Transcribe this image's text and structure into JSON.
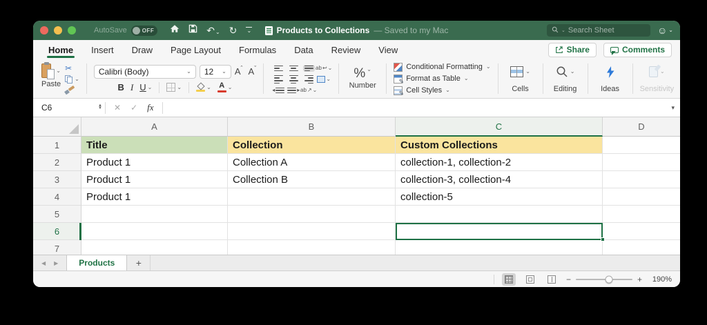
{
  "colors": {
    "accent": "#217346",
    "titlebar_green": "#3a6b4f",
    "selection_green": "#1e7145",
    "fill_green": "#cbdfb8",
    "fill_yellow": "#fae49e"
  },
  "titlebar": {
    "autosave_label": "AutoSave",
    "autosave_state": "OFF",
    "doc_title": "Products to Collections",
    "doc_status": "— Saved to my Mac",
    "search_placeholder": "Search Sheet"
  },
  "ribbon": {
    "tabs": [
      {
        "label": "Home"
      },
      {
        "label": "Insert"
      },
      {
        "label": "Draw"
      },
      {
        "label": "Page Layout"
      },
      {
        "label": "Formulas"
      },
      {
        "label": "Data"
      },
      {
        "label": "Review"
      },
      {
        "label": "View"
      }
    ],
    "active_tab": "Home",
    "share_label": "Share",
    "comments_label": "Comments"
  },
  "toolbar": {
    "paste_label": "Paste",
    "font_name": "Calibri (Body)",
    "font_size": "12",
    "bold": "B",
    "italic": "I",
    "underline": "U",
    "grow_letter": "A",
    "shrink_letter": "A",
    "percent_symbol": "%",
    "number_label": "Number",
    "conditional_formatting_label": "Conditional Formatting",
    "format_as_table_label": "Format as Table",
    "cell_styles_label": "Cell Styles",
    "cells_label": "Cells",
    "editing_label": "Editing",
    "ideas_label": "Ideas",
    "sensitivity_label": "Sensitivity",
    "wrap_ab": "ab",
    "orient_ab": "ab"
  },
  "formula_bar": {
    "name_box": "C6",
    "fx_label": "fx"
  },
  "sheet": {
    "columns": [
      "A",
      "B",
      "C",
      "D"
    ],
    "selected_column": "C",
    "selected_cell": "C6",
    "rows": [
      {
        "n": "1",
        "a": "Title",
        "b": "Collection",
        "c": "Custom Collections"
      },
      {
        "n": "2",
        "a": "Product 1",
        "b": "Collection A",
        "c": "collection-1, collection-2"
      },
      {
        "n": "3",
        "a": "Product 1",
        "b": "Collection B",
        "c": "collection-3, collection-4"
      },
      {
        "n": "4",
        "a": "Product 1",
        "b": "",
        "c": "collection-5"
      },
      {
        "n": "5",
        "a": "",
        "b": "",
        "c": ""
      },
      {
        "n": "6",
        "a": "",
        "b": "",
        "c": ""
      },
      {
        "n": "7",
        "a": "",
        "b": "",
        "c": ""
      }
    ],
    "tab_name": "Products",
    "add_tab_label": "+"
  },
  "status_bar": {
    "zoom_level": "190%"
  },
  "icons": {
    "chevron_down": "⌄",
    "undo": "↶",
    "redo": "↻",
    "scissors": "✂",
    "smiley": "☺",
    "cancel": "✕",
    "confirm": "✓",
    "stepper_up": "▲",
    "stepper_down": "▼",
    "tab_prev": "◀",
    "tab_next": "▶",
    "formula_dropdown": "▾",
    "minus": "−",
    "plus": "+",
    "caret_up": "ˆ",
    "caret_down": "ˇ",
    "wrap_arrow": "↩",
    "orient_arrow": "↗",
    "pencil": "✎",
    "dec_indent": "◂",
    "inc_indent": "▸"
  }
}
